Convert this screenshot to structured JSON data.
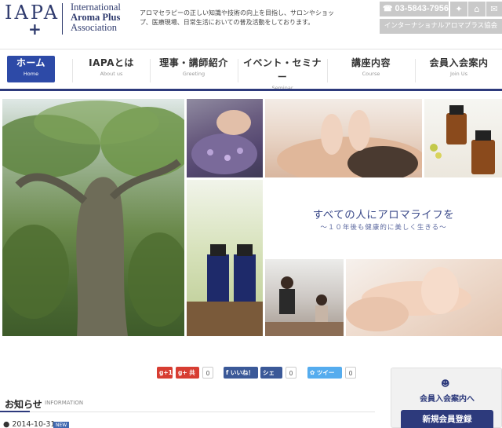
{
  "brand": {
    "mark": "IAPA",
    "mark_plus": "+",
    "name_line1": "International",
    "name_line2": "Aroma Plus",
    "name_line3": "Association",
    "tagline": "アロマセラピーの正しい知識や技術の向上を目指し、サロンやショップ、医療現場、日常生活においての普及活動をしております。"
  },
  "header": {
    "phone": "03-5843-7956",
    "association_label": "インターナショナルアロマプラス協会",
    "icons": [
      "sitemap-icon",
      "home-icon",
      "mail-icon"
    ]
  },
  "nav": {
    "items": [
      {
        "jp": "ホーム",
        "en": "Home"
      },
      {
        "jp": "IAPAとは",
        "en": "About us"
      },
      {
        "jp": "理事・講師紹介",
        "en": "Greeting"
      },
      {
        "jp": "イベント・セミナー",
        "en": "Seminar"
      },
      {
        "jp": "講座内容",
        "en": "Course"
      },
      {
        "jp": "会員入会案内",
        "en": "Join Us"
      }
    ]
  },
  "hero": {
    "slogan": "すべての人にアロマライフを",
    "subslogan": "～１０年後も健康的に美しく生きる～"
  },
  "social": {
    "gplus_label": "g+1",
    "gplus_share_label": "共有",
    "gplus_count": "0",
    "fb_like_label": "いいね！",
    "fb_share_label": "シェア",
    "fb_count": "0",
    "tweet_label": "ツイート",
    "tweet_count": "0"
  },
  "news": {
    "title": "お知らせ",
    "title_en": "INFORMATION",
    "items": [
      {
        "date": "2014-10-31",
        "badge": "NEW"
      }
    ]
  },
  "member": {
    "title": "会員入会案内へ",
    "button_label": "新規会員登録"
  },
  "colors": {
    "brand_navy": "#2d3a7c",
    "nav_active": "#2d4aa7",
    "header_gray": "#c9c9c9"
  }
}
